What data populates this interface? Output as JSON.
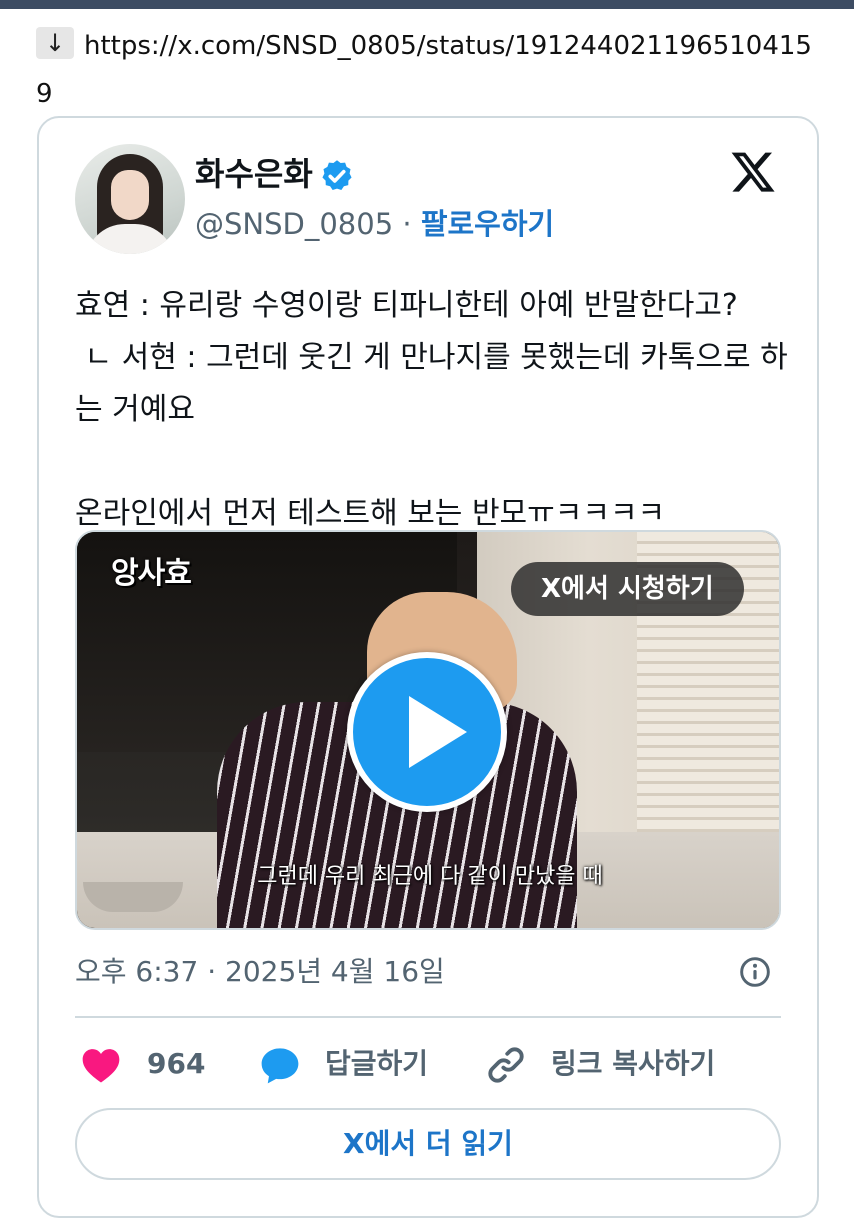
{
  "url_line": {
    "arrow": "↓",
    "url": "https://x.com/SNSD_0805/status/1912440211965104159"
  },
  "tweet": {
    "display_name": "화수은화",
    "handle": "@SNSD_0805",
    "separator": " · ",
    "follow_label": "팔로우하기",
    "text": "효연 : 유리랑 수영이랑 티파니한테 아예 반말한다고?\n ㄴ 서현 : 그런데 웃긴 게 만나지를 못했는데 카톡으로 하는 거예요\n\n온라인에서 먼저 테스트해 보는 반모ㅠㅋㅋㅋㅋ",
    "timestamp": "오후 6:37 · 2025년 4월 16일",
    "like_count": "964",
    "reply_label": "답글하기",
    "copy_link_label": "링크 복사하기",
    "read_more_label": "X에서 더 읽기"
  },
  "media": {
    "channel_logo": "앙사효",
    "watch_label": "X에서 시청하기",
    "subtitle": "그런데 우리 최근에 다 같이 만났을 때"
  },
  "colors": {
    "link_blue": "#1d75c8",
    "verified_blue": "#1d9bf0",
    "heart_pink": "#f91880",
    "muted_text": "#536471",
    "border": "#cfd9de",
    "top_bar": "#3d4c63"
  },
  "icons": [
    "arrow-down-icon",
    "verified-badge-icon",
    "x-logo-icon",
    "play-icon",
    "info-icon",
    "heart-icon",
    "reply-bubble-icon",
    "link-icon"
  ]
}
